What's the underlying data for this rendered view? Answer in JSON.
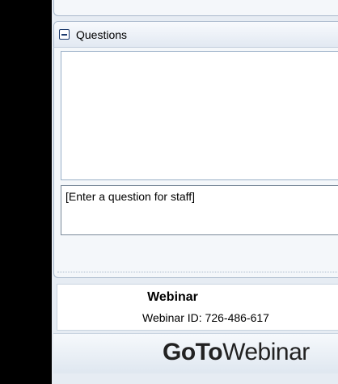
{
  "questions": {
    "title": "Questions",
    "input_placeholder": "[Enter a question for staff]"
  },
  "webinar": {
    "name": "Webinar",
    "id_text": "Webinar ID: 726-486-617"
  },
  "brand": {
    "logo_bold": "GoTo",
    "logo_light": "Webinar"
  }
}
